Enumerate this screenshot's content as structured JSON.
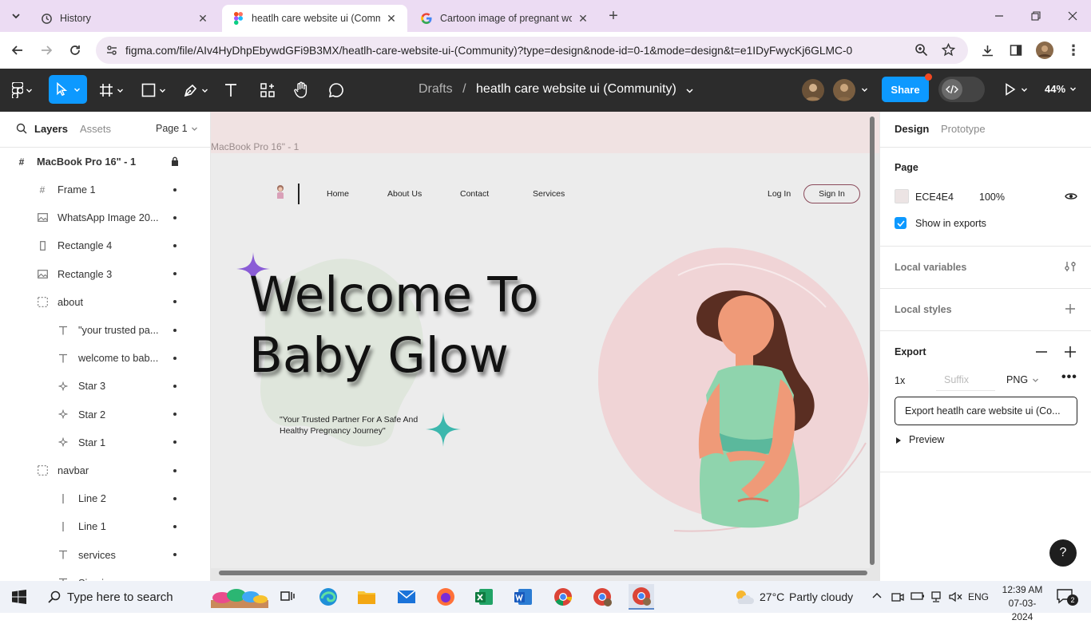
{
  "browser": {
    "tabs": [
      {
        "title": "History",
        "icon": "history-icon",
        "active": false
      },
      {
        "title": "heatlh care website ui (Commun",
        "icon": "figma-icon",
        "active": true
      },
      {
        "title": "Cartoon image of pregnant wor",
        "icon": "google-icon",
        "active": false
      }
    ],
    "url": "figma.com/file/AIv4HyDhpEbywdGFi9B3MX/heatlh-care-website-ui-(Community)?type=design&node-id=0-1&mode=design&t=e1IDyFwycKj6GLMC-0"
  },
  "figma": {
    "breadcrumb_root": "Drafts",
    "breadcrumb_sep": "/",
    "file_name": "heatlh care website ui (Community)",
    "share_label": "Share",
    "zoom": "44%"
  },
  "layers_panel": {
    "tab_layers": "Layers",
    "tab_assets": "Assets",
    "page_select": "Page 1",
    "root": "MacBook Pro 16\" - 1",
    "items": [
      {
        "label": "Frame 1",
        "icon": "frame-icon",
        "indent": 1
      },
      {
        "label": "WhatsApp Image 20...",
        "icon": "image-icon",
        "indent": 1
      },
      {
        "label": "Rectangle 4",
        "icon": "rectangle-icon",
        "indent": 1
      },
      {
        "label": "Rectangle 3",
        "icon": "image-icon",
        "indent": 1
      },
      {
        "label": "about",
        "icon": "group-icon",
        "indent": 1
      },
      {
        "label": "\"your trusted pa...",
        "icon": "text-icon",
        "indent": 2
      },
      {
        "label": "welcome to bab...",
        "icon": "text-icon",
        "indent": 2
      },
      {
        "label": "Star 3",
        "icon": "star-icon",
        "indent": 2
      },
      {
        "label": "Star 2",
        "icon": "star-icon",
        "indent": 2
      },
      {
        "label": "Star 1",
        "icon": "star-icon",
        "indent": 2
      },
      {
        "label": "navbar",
        "icon": "group-icon",
        "indent": 1
      },
      {
        "label": "Line 2",
        "icon": "line-icon",
        "indent": 2
      },
      {
        "label": "Line 1",
        "icon": "line-icon",
        "indent": 2
      },
      {
        "label": "services",
        "icon": "text-icon",
        "indent": 2
      },
      {
        "label": "Sign in",
        "icon": "text-icon",
        "indent": 2
      }
    ]
  },
  "canvas": {
    "frame_label": "MacBook Pro 16\" - 1",
    "nav": {
      "home": "Home",
      "about": "About Us",
      "contact": "Contact",
      "services": "Services",
      "login": "Log In",
      "signin": "Sign In"
    },
    "hero_line1": "Welcome To",
    "hero_line2": "Baby Glow",
    "tagline_1": "\"Your Trusted Partner For A Safe And",
    "tagline_2": "Healthy Pregnancy Journey\""
  },
  "right_panel": {
    "tab_design": "Design",
    "tab_prototype": "Prototype",
    "page_title": "Page",
    "page_color": "ECE4E4",
    "page_opacity": "100%",
    "show_in_exports": "Show in exports",
    "local_variables": "Local variables",
    "local_styles": "Local styles",
    "export_title": "Export",
    "export_scale": "1x",
    "export_suffix_placeholder": "Suffix",
    "export_format": "PNG",
    "export_button": "Export heatlh care website ui (Co...",
    "preview": "Preview",
    "help": "?"
  },
  "taskbar": {
    "search_placeholder": "Type here to search",
    "temperature": "27°C",
    "weather": "Partly cloudy",
    "language": "ENG",
    "time": "12:39 AM",
    "date": "07-03-2024",
    "notifications": "2"
  },
  "colors": {
    "figma_toolbar": "#2c2c2c",
    "figma_blue": "#0d99ff",
    "tab_strip": "#ecdcf3",
    "page_bg": "#ECE4E4"
  }
}
